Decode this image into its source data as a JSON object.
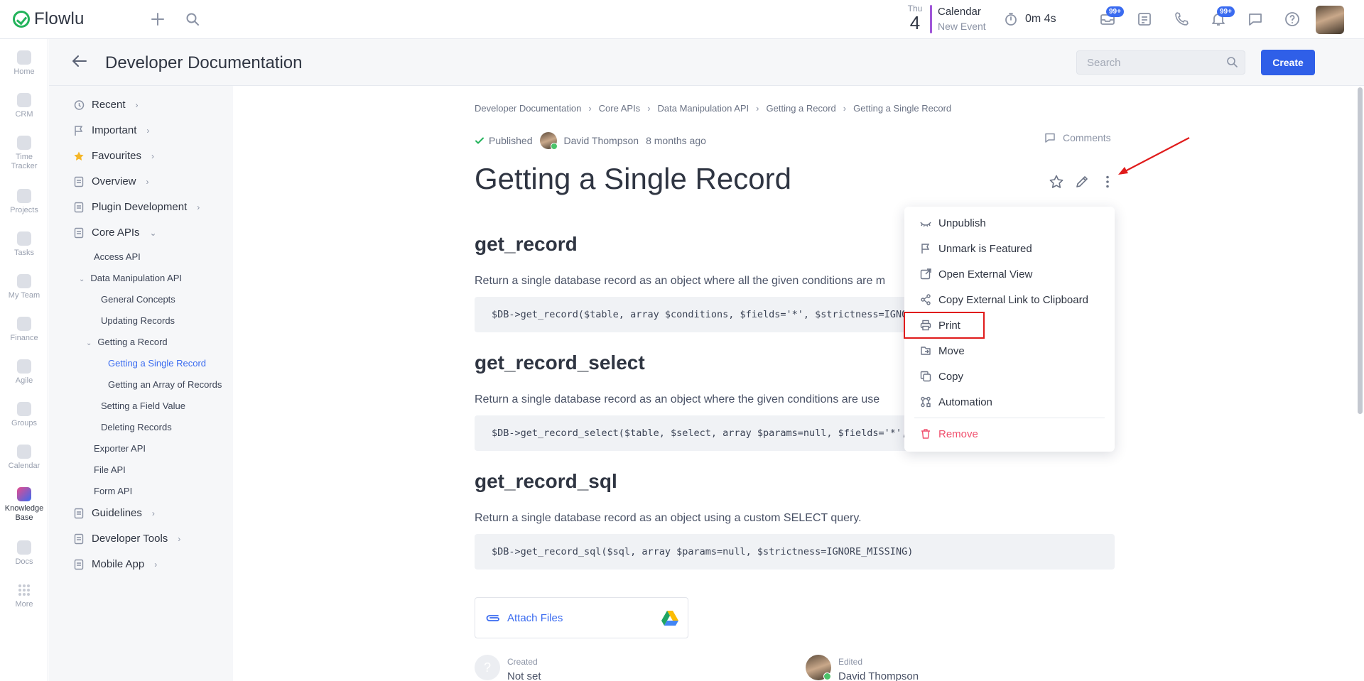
{
  "app": {
    "name": "Flowlu"
  },
  "topbar": {
    "date": {
      "dow": "Thu",
      "day": "4"
    },
    "calendar": {
      "title": "Calendar",
      "subtitle": "New Event"
    },
    "timer": "0m 4s",
    "badges": {
      "inbox": "99+",
      "notifications": "99+"
    },
    "icons": [
      "add-icon",
      "search-icon",
      "timer-icon",
      "inbox-icon",
      "notes-icon",
      "phone-icon",
      "bell-icon",
      "chat-icon",
      "help-icon"
    ]
  },
  "rail": [
    {
      "label": "Home",
      "icon": "home-icon"
    },
    {
      "label": "CRM",
      "icon": "crm-icon"
    },
    {
      "label": "Time Tracker",
      "icon": "time-tracker-icon"
    },
    {
      "label": "Projects",
      "icon": "projects-icon"
    },
    {
      "label": "Tasks",
      "icon": "tasks-icon"
    },
    {
      "label": "My Team",
      "icon": "my-team-icon"
    },
    {
      "label": "Finance",
      "icon": "finance-icon"
    },
    {
      "label": "Agile",
      "icon": "agile-icon"
    },
    {
      "label": "Groups",
      "icon": "groups-icon"
    },
    {
      "label": "Calendar",
      "icon": "calendar-icon"
    },
    {
      "label": "Knowledge Base",
      "icon": "knowledge-base-icon",
      "active": true
    },
    {
      "label": "Docs",
      "icon": "docs-icon"
    },
    {
      "label": "More",
      "icon": "more-icon"
    }
  ],
  "header": {
    "title": "Developer Documentation",
    "search_placeholder": "Search",
    "create_label": "Create"
  },
  "tree": {
    "top": [
      {
        "label": "Recent",
        "icon": "history-icon"
      },
      {
        "label": "Important",
        "icon": "flag-icon"
      },
      {
        "label": "Favourites",
        "icon": "star-icon"
      },
      {
        "label": "Overview",
        "icon": "doc-icon"
      },
      {
        "label": "Plugin Development",
        "icon": "doc-icon"
      },
      {
        "label": "Core APIs",
        "icon": "doc-icon"
      }
    ],
    "sub": [
      {
        "label": "Access API"
      },
      {
        "label": "Data Manipulation API"
      },
      {
        "label": "General Concepts"
      },
      {
        "label": "Updating Records"
      },
      {
        "label": "Getting a Record"
      },
      {
        "label": "Getting a Single Record",
        "active": true
      },
      {
        "label": "Getting an Array of Records"
      },
      {
        "label": "Setting a Field Value"
      },
      {
        "label": "Deleting Records"
      },
      {
        "label": "Exporter API"
      },
      {
        "label": "File API"
      },
      {
        "label": "Form API"
      }
    ],
    "bottom": [
      {
        "label": "Guidelines",
        "icon": "doc-icon"
      },
      {
        "label": "Developer Tools",
        "icon": "doc-icon"
      },
      {
        "label": "Mobile App",
        "icon": "doc-icon"
      }
    ]
  },
  "breadcrumb": [
    "Developer Documentation",
    "Core APIs",
    "Data Manipulation API",
    "Getting a Record",
    "Getting a Single Record"
  ],
  "meta": {
    "status": "Published",
    "author": "David Thompson",
    "time": "8 months ago",
    "comments": "Comments"
  },
  "doc": {
    "title": "Getting a Single Record",
    "sections": [
      {
        "heading": "get_record",
        "text": "Return a single database record as an object where all the given conditions are m",
        "code": "$DB->get_record($table, array $conditions, $fields='*', $strictness=IGNORE_MISSING)"
      },
      {
        "heading": "get_record_select",
        "text": "Return a single database record as an object where the given conditions are use",
        "code": "$DB->get_record_select($table, $select, array $params=null, $fields='*', $strictness=IGNORE_MISSING)"
      },
      {
        "heading": "get_record_sql",
        "text": "Return a single database record as an object using a custom SELECT query.",
        "code": "$DB->get_record_sql($sql, array $params=null, $strictness=IGNORE_MISSING)"
      }
    ],
    "attach_label": "Attach Files",
    "created": {
      "label": "Created",
      "value": "Not set",
      "avatar": "?"
    },
    "edited": {
      "label": "Edited",
      "value": "David Thompson"
    }
  },
  "menu": {
    "items": [
      {
        "label": "Unpublish",
        "icon": "unpublish-icon"
      },
      {
        "label": "Unmark is Featured",
        "icon": "flag-icon"
      },
      {
        "label": "Open External View",
        "icon": "external-link-icon"
      },
      {
        "label": "Copy External Link to Clipboard",
        "icon": "share-icon"
      },
      {
        "label": "Print",
        "icon": "print-icon",
        "highlighted": true
      },
      {
        "label": "Move",
        "icon": "move-icon"
      },
      {
        "label": "Copy",
        "icon": "copy-icon"
      },
      {
        "label": "Automation",
        "icon": "automation-icon"
      },
      {
        "label": "Remove",
        "icon": "trash-icon",
        "danger": true
      }
    ]
  },
  "colors": {
    "accent": "#2f5fe8",
    "link": "#3a6bf0",
    "success": "#23b35b",
    "danger": "#f0506e",
    "annotation": "#e01b1b"
  }
}
